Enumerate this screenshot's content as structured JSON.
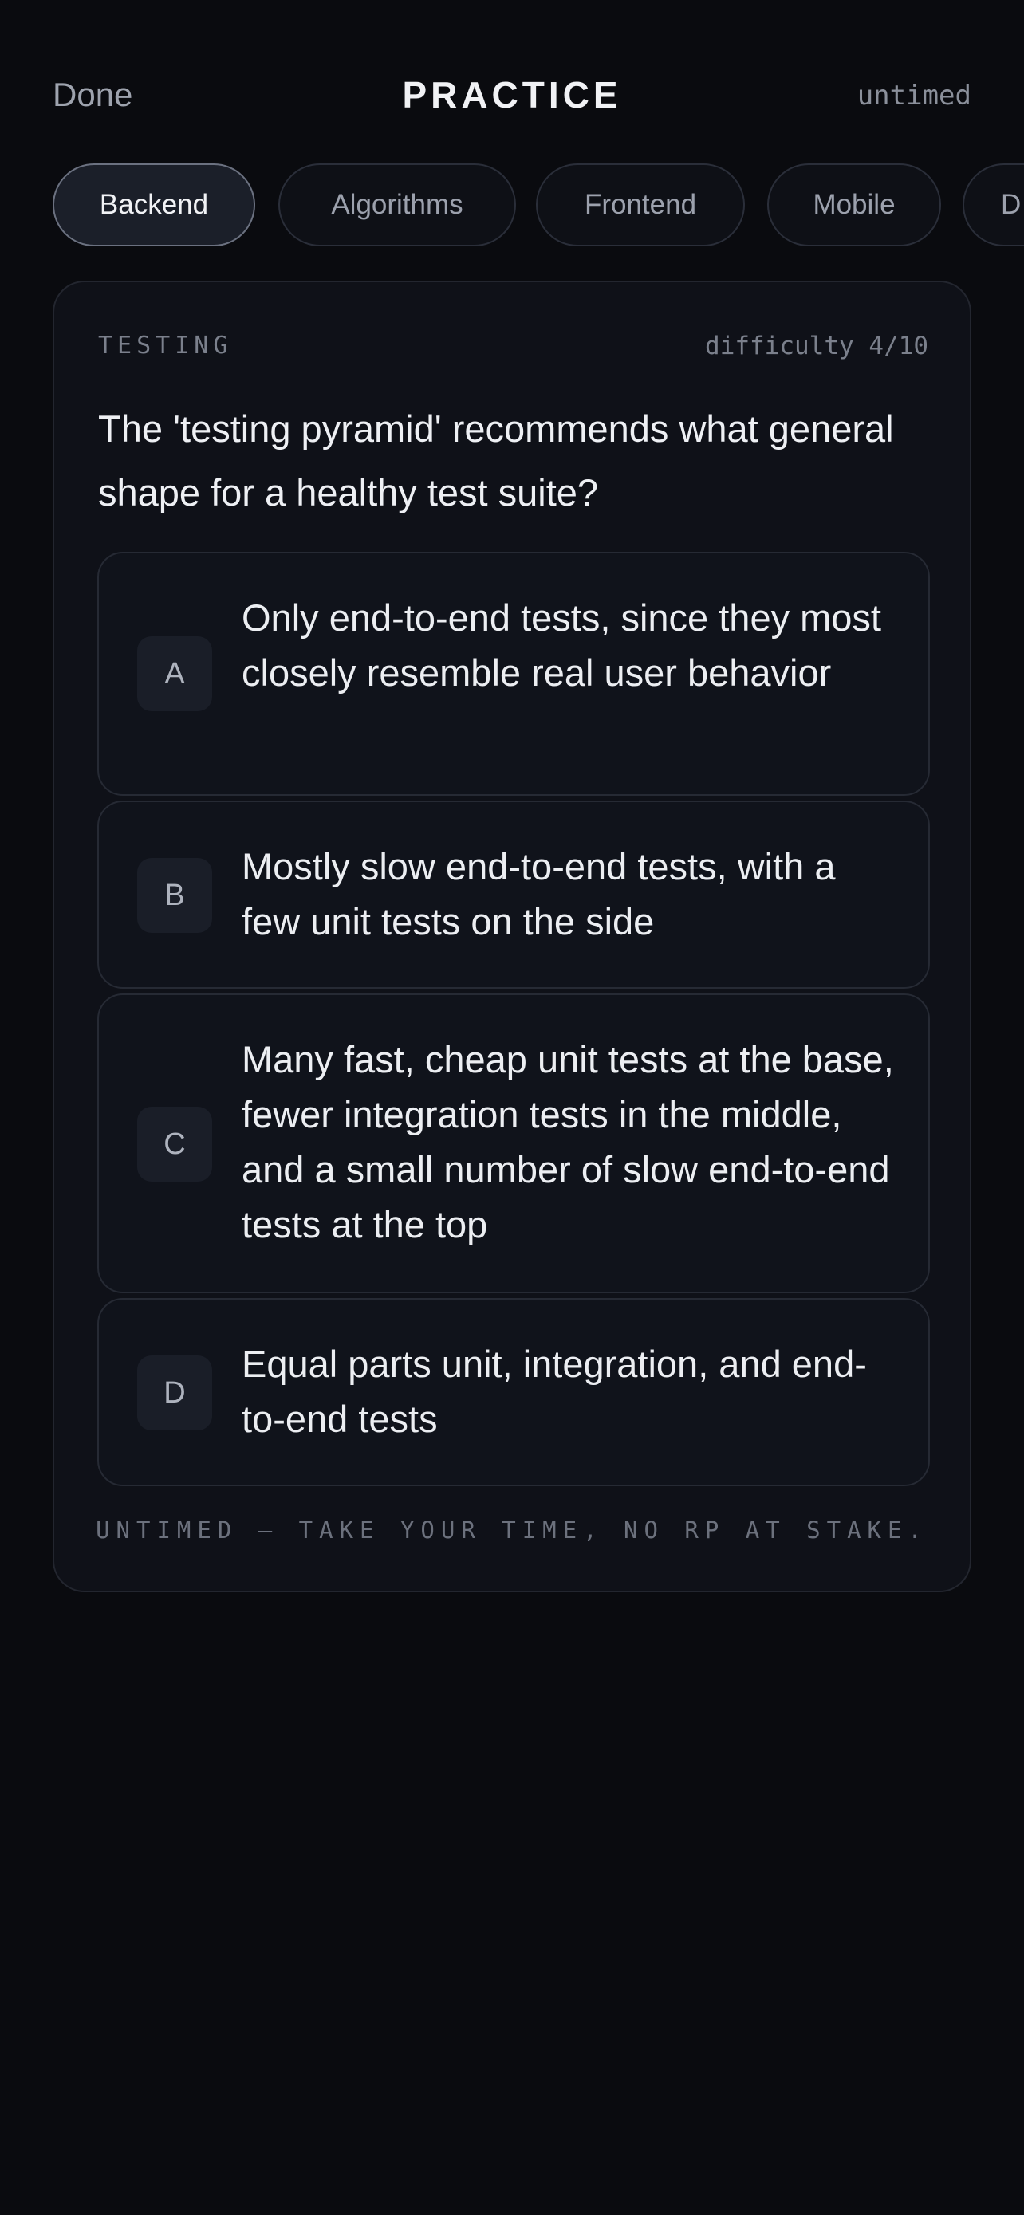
{
  "header": {
    "done_label": "Done",
    "title": "PRACTICE",
    "mode": "untimed"
  },
  "tabs": [
    {
      "label": "Backend",
      "active": true
    },
    {
      "label": "Algorithms",
      "active": false
    },
    {
      "label": "Frontend",
      "active": false
    },
    {
      "label": "Mobile",
      "active": false
    },
    {
      "label": "D",
      "active": false
    }
  ],
  "question": {
    "topic": "TESTING",
    "difficulty": "difficulty 4/10",
    "text": "The 'testing pyramid' recommends what general shape for a healthy test suite?",
    "options": [
      {
        "letter": "A",
        "text": "Only end-to-end tests, since they most closely resemble real user behavior"
      },
      {
        "letter": "B",
        "text": "Mostly slow end-to-end tests, with a few unit tests on the side"
      },
      {
        "letter": "C",
        "text": "Many fast, cheap unit tests at the base, fewer integration tests in the middle, and a small number of slow end-to-end tests at the top"
      },
      {
        "letter": "D",
        "text": "Equal parts unit, integration, and end-to-end tests"
      }
    ],
    "footer_note": "UNTIMED — TAKE YOUR TIME, NO RP AT STAKE."
  },
  "colors": {
    "background": "#0a0b0f",
    "card": "#0f1118",
    "active_tab": "#1b1f29"
  }
}
